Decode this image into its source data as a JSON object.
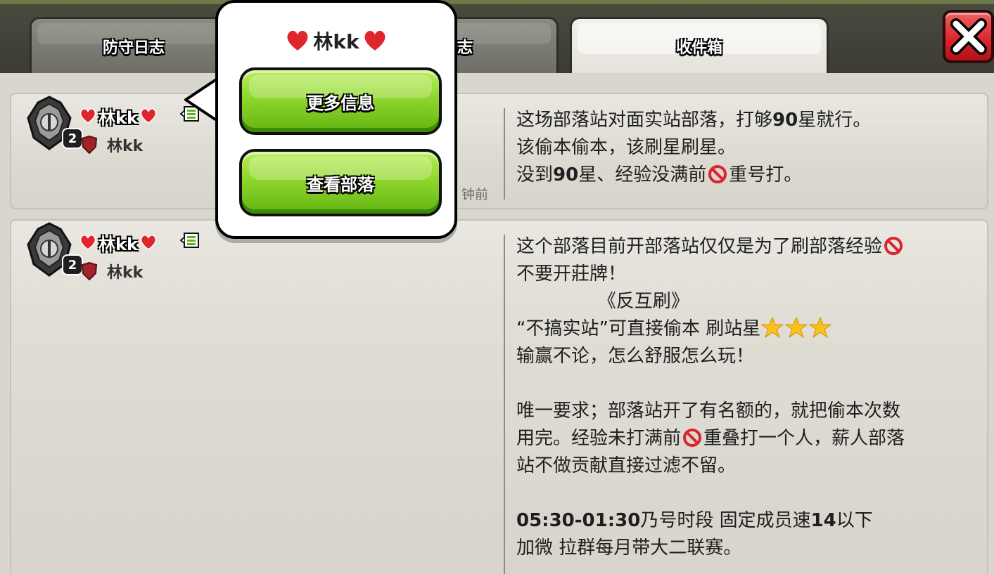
{
  "tabs": [
    {
      "label": "防守日志",
      "active": false
    },
    {
      "label": "进攻日志",
      "active": false,
      "visible_fragment": "志"
    },
    {
      "label": "收件箱",
      "active": true
    }
  ],
  "close_label": "X",
  "colors": {
    "accent_green": "#8fd62c",
    "close_red": "#d9232a",
    "heart_red": "#e0262d"
  },
  "messages": [
    {
      "sender_name": "林kk",
      "level": "2",
      "clan_name": "林kk",
      "timestamp_fragment": "钟前",
      "lines": [
        "这场部落站对面实站部落，打够90星就行。",
        "该偷本偷本，该刷星刷星。",
        "没到90星、经验没满前🚫重号打。"
      ]
    },
    {
      "sender_name": "林kk",
      "level": "2",
      "clan_name": "林kk",
      "lines": [
        "这个部落目前开部落站仅仅是为了刷部落经验🚫",
        "不要开莊牌！",
        "              《反互刷》",
        "“不搞实站”可直接偷本 刷站星⭐⭐⭐",
        "输赢不论，怎么舒服怎么玩！",
        "",
        "唯一要求；部落站开了有名额的，就把偷本次数",
        "用完。经验未打满前🚫重叠打一个人，薪人部落",
        "站不做贡献直接过滤不留。",
        "",
        "05:30-01:30乃号时段 固定成员速14以下",
        "加微 拉群每月带大二联赛。"
      ]
    }
  ],
  "popup": {
    "name": "林kk",
    "more_info_label": "更多信息",
    "view_clan_label": "查看部落"
  }
}
